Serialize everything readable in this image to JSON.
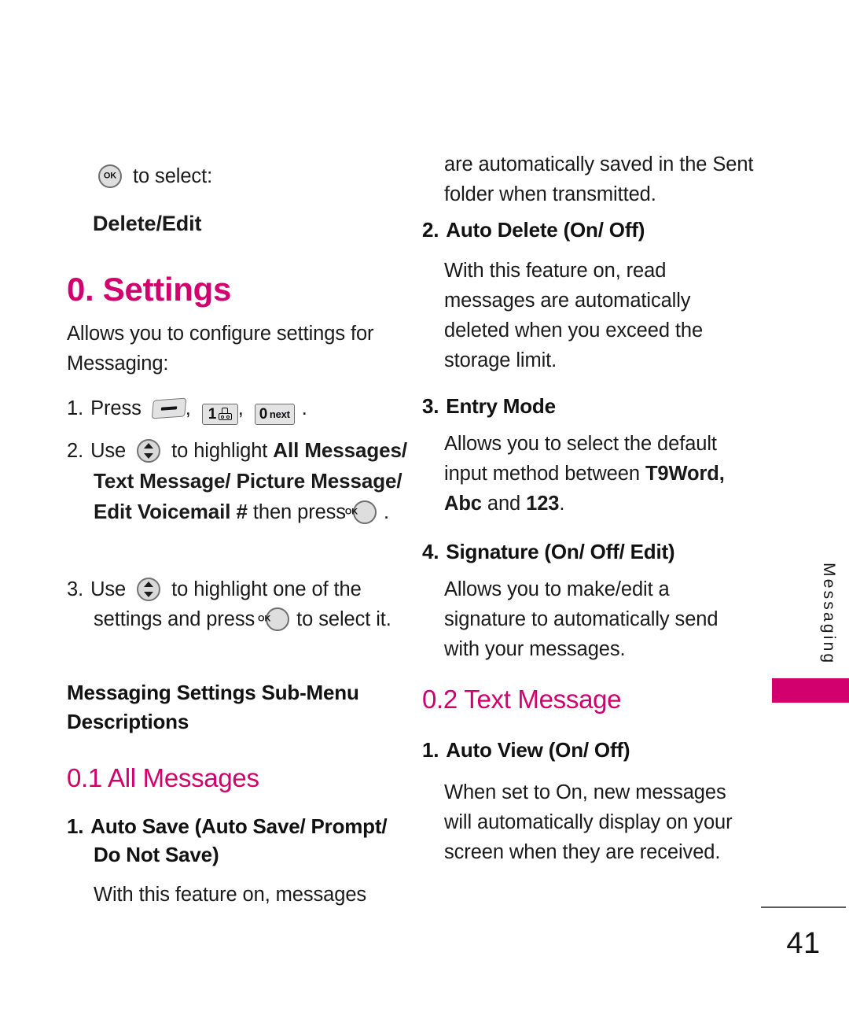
{
  "page": {
    "number": "41",
    "side_tab_label": "Messaging",
    "accent_color": "#d1006e"
  },
  "left_column": {
    "intro": {
      "ok_icon": "ok-key-icon",
      "text_after_icon": "to select:",
      "bold_line": "Delete/Edit"
    },
    "section_heading": "0. Settings",
    "section_intro": "Allows you to configure settings for Messaging:",
    "steps": [
      {
        "number": "1.",
        "lead": "Press",
        "keys": [
          "left-soft-key-icon",
          "key-1-voicemail-icon",
          "key-0-next-icon"
        ],
        "key_1_digit": "1",
        "key_0_digit": "0",
        "key_0_label": "next",
        "comma": ",",
        "period": "."
      },
      {
        "number": "2.",
        "lead": "Use",
        "nav_icon": "navigation-key-icon",
        "mid": "to highlight",
        "bold_target": "All Messages/ Text Message/ Picture Message/ Edit Voicemail #",
        "tail": "then press",
        "ok_icon": "ok-key-icon",
        "period": "."
      },
      {
        "number": "3.",
        "lead": "Use",
        "nav_icon": "navigation-key-icon",
        "mid": "to highlight one of the settings and press",
        "ok_icon": "ok-key-icon",
        "tail": "to select it."
      }
    ],
    "submenu_heading": "Messaging Settings Sub-Menu Descriptions",
    "subsection_heading": "0.1 All Messages",
    "items": [
      {
        "number": "1.",
        "title": "Auto Save (Auto Save/ Prompt/ Do Not Save)",
        "body": "With this feature on, messages"
      }
    ]
  },
  "right_column": {
    "continuation": "are automatically saved in the Sent folder when transmitted.",
    "items": [
      {
        "number": "2.",
        "title": "Auto Delete (On/ Off)",
        "body": "With this feature on, read messages are automatically deleted when you exceed the storage limit."
      },
      {
        "number": "3.",
        "title": "Entry Mode",
        "body_pre": "Allows you to select the default input method between",
        "body_bold_1": "T9Word, Abc",
        "body_mid": "and",
        "body_bold_2": "123",
        "body_end": "."
      },
      {
        "number": "4.",
        "title": "Signature (On/ Off/ Edit)",
        "body": "Allows you to make/edit a signature to automatically send with your messages."
      }
    ],
    "subsection_heading": "0.2 Text Message",
    "items2": [
      {
        "number": "1.",
        "title": "Auto View (On/ Off)",
        "body": "When set to On, new messages will automatically display on your screen when they are received."
      }
    ]
  }
}
